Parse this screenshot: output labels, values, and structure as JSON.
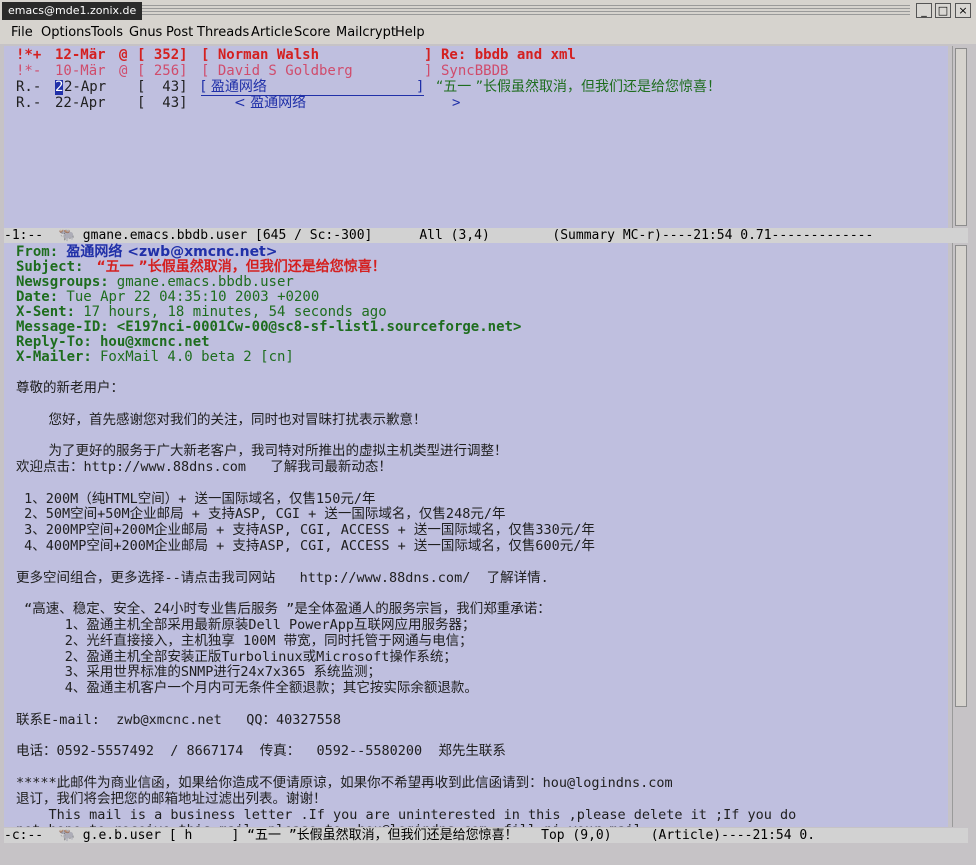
{
  "window": {
    "title": "emacs@mde1.zonix.de",
    "buttons": [
      "_",
      "□",
      "×"
    ]
  },
  "menubar": [
    "File",
    "Options",
    "Tools",
    "Gnus",
    "Post",
    "Threads",
    "Article",
    "Score",
    "Mailcrypt",
    "Help"
  ],
  "summary": {
    "rows": [
      {
        "mark": "!*+",
        "date": "12-Mär",
        "score": "@",
        "count": "[ 352]",
        "from": "[ Norman Walsh",
        "close": "]",
        "subject": "Re: bbdb and xml"
      },
      {
        "mark": "!*-",
        "date": "10-Mär",
        "score": "@",
        "count": "[ 256]",
        "from": "[ David S Goldberg",
        "close": "]",
        "subject": "SyncBBDB"
      },
      {
        "mark": "R.-",
        "cursor": "2",
        "date": "2-Apr",
        "count": "[  43]",
        "from": "[ 盈通网络",
        "close": "]",
        "subject": "“五一 ”长假虽然取消，但我们还是给您惊喜！"
      },
      {
        "mark": "R.-",
        "date": "22-Apr",
        "count": "[  43]",
        "from": "< 盈通网络",
        "close": ">"
      }
    ],
    "modeline": "-1:--  🐃 gmane.emacs.bbdb.user [645 / Sc:-300]      All (3,4)        (Summary MC-r)----21:54 0.71-------------"
  },
  "article": {
    "headers": [
      {
        "label": "From:",
        "value": "盈通网络 <zwb@xmcnc.net>"
      },
      {
        "label": "Subject:",
        "value": " “五一 ”长假虽然取消，但我们还是给您惊喜！"
      },
      {
        "label": "Newsgroups:",
        "value": "gmane.emacs.bbdb.user"
      },
      {
        "label": "Date:",
        "value": "Tue Apr 22 04:35:10 2003 +0200"
      },
      {
        "label": "X-Sent:",
        "value": "17 hours, 18 minutes, 54 seconds ago"
      },
      {
        "label": "Message-ID:",
        "value": "<E197nci-0001Cw-00@sc8-sf-list1.sourceforge.net>"
      },
      {
        "label": "Reply-To:",
        "value": "hou@xmcnc.net"
      },
      {
        "label": "X-Mailer:",
        "value": "FoxMail 4.0 beta 2 [cn]"
      }
    ],
    "body": [
      "尊敬的新老用户：",
      "",
      "    您好，首先感谢您对我们的关注，同时也对冒昧打扰表示歉意！",
      "",
      "    为了更好的服务于广大新老客户，我司特对所推出的虚拟主机类型进行调整！",
      "欢迎点击：http://www.88dns.com   了解我司最新动态！",
      "",
      " 1、200M（纯HTML空间）+ 送一国际域名，仅售150元/年",
      " 2、50M空间+50M企业邮局 + 支持ASP, CGI + 送一国际域名，仅售248元/年",
      " 3、200MP空间+200M企业邮局 + 支持ASP, CGI, ACCESS + 送一国际域名，仅售330元/年",
      " 4、400MP空间+200M企业邮局 + 支持ASP, CGI, ACCESS + 送一国际域名，仅售600元/年",
      "",
      "更多空间组合，更多选择--请点击我司网站   http://www.88dns.com/  了解详情.",
      "",
      " “高速、稳定、安全、24小时专业售后服务 ”是全体盈通人的服务宗旨，我们郑重承诺：",
      "      1、盈通主机全部采用最新原装Dell PowerApp互联网应用服务器；",
      "      2、光纤直接接入，主机独享 100M 带宽，同时托管于网通与电信；",
      "      2、盈通主机全部安装正版Turbolinux或Microsoft操作系统；",
      "      3、采用世界标准的SNMP进行24x7x365 系统监测；",
      "      4、盈通主机客户一个月内可无条件全额退款；其它按实际余额退款。",
      "",
      "联系E-mail:  zwb@xmcnc.net   QQ：40327558",
      "",
      "电话：0592-5557492  / 8667174  传真：  0592--5580200  郑先生联系",
      "",
      "*****此邮件为商业信函，如果给你造成不便请原谅，如果你不希望再收到此信函请到：hou@logindns.com",
      "退订，我们将会把您的邮箱地址过滤出列表。谢谢！",
      "    This mail is a business letter .If you are uninterested in this ,please delete it ;If you do",
      "not hope to receive this mail ,please to  hou@logindns.com  fill ni your mail"
    ],
    "modeline": "-c:--  🐃 g.e.b.user [ h     ] “五一 ”长假虽然取消，但我们还是给您惊喜！   Top (9,0)     (Article)----21:54 0."
  }
}
